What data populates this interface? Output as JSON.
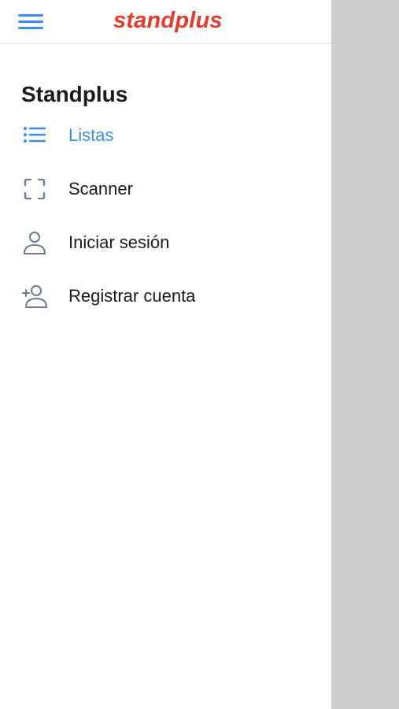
{
  "colors": {
    "accent": "#3b8de8",
    "brand": "#e6392b",
    "icon_gray": "#6b7a90",
    "text": "#1a1a1a",
    "overlay": "#cccccc"
  },
  "header": {
    "menu_icon": "hamburger-menu-icon",
    "logo_text": "standplus"
  },
  "drawer": {
    "title": "Standplus",
    "items": [
      {
        "label": "Listas",
        "icon": "list-icon",
        "active": true
      },
      {
        "label": "Scanner",
        "icon": "scan-frame-icon",
        "active": false
      },
      {
        "label": "Iniciar sesión",
        "icon": "user-icon",
        "active": false
      },
      {
        "label": "Registrar cuenta",
        "icon": "add-user-icon",
        "active": false
      }
    ]
  }
}
